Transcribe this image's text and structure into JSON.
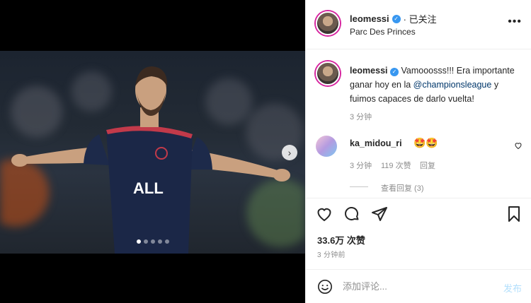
{
  "post": {
    "carousel_total": 5,
    "carousel_active": 0
  },
  "header": {
    "username": "leomessi",
    "follow_state": "· 已关注",
    "location": "Parc Des Princes",
    "more_label": "•••"
  },
  "caption": {
    "username": "leomessi",
    "text_before": " Vamooosss!!! Era importante ganar hoy en la ",
    "mention": "@championsleague",
    "text_after": " y fuimos capaces de darlo vuelta!",
    "age": "3 分钟"
  },
  "comment": {
    "username": "ka_midou_ri",
    "text": "🤩🤩",
    "age": "3 分钟",
    "likes": "119 次赞",
    "reply_label": "回复",
    "view_replies": "查看回复 (3)"
  },
  "stats": {
    "likes": "33.6万 次赞",
    "time": "3 分钟前"
  },
  "comment_box": {
    "placeholder": "添加评论...",
    "post_label": "发布"
  },
  "colors": {
    "verified": "#3897f0",
    "link": "#00376b",
    "post_disabled": "#b2dffc",
    "ring": "#d6249f"
  }
}
